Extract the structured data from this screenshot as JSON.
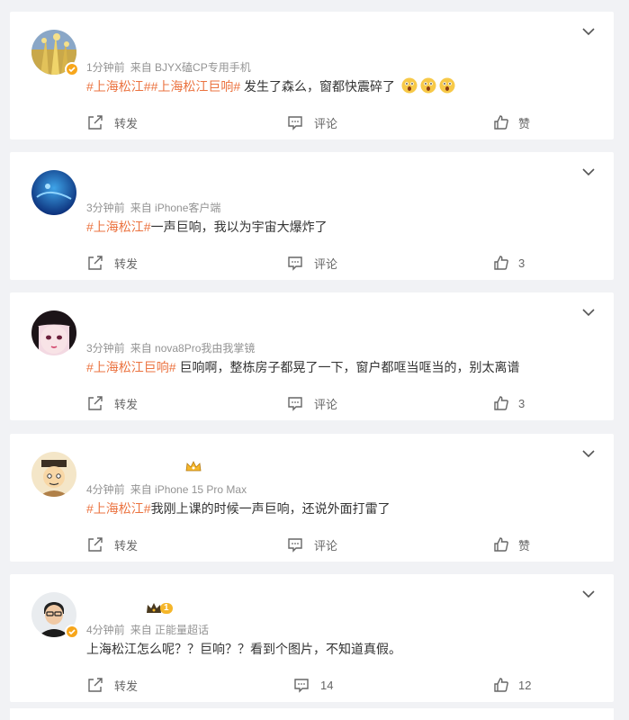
{
  "posts": [
    {
      "time": "1分钟前",
      "source": "来自 BJYX磕CP专用手机",
      "tags": [
        "#上海松江#",
        "#上海松江巨响#"
      ],
      "text": " 发生了森么，窗都快震碎了",
      "emoji_count": 3,
      "emoji_name": "shocked-face-emoji",
      "share_label": "转发",
      "comment_label": "评论",
      "like_label": "赞",
      "verified": true
    },
    {
      "time": "3分钟前",
      "source": "来自 iPhone客户端",
      "tags": [
        "#上海松江#"
      ],
      "text": "一声巨响，我以为宇宙大爆炸了",
      "share_label": "转发",
      "comment_label": "评论",
      "like_label": "3",
      "verified": false
    },
    {
      "time": "3分钟前",
      "source": "来自 nova8Pro我由我掌镜",
      "tags": [
        "#上海松江巨响#"
      ],
      "text": " 巨响啊，整栋房子都晃了一下，窗户都哐当哐当的，别太离谱",
      "share_label": "转发",
      "comment_label": "评论",
      "like_label": "3",
      "verified": false
    },
    {
      "time": "4分钟前",
      "source": "来自 iPhone 15 Pro Max",
      "tags": [
        "#上海松江#"
      ],
      "text": "我刚上课的时候一声巨响，还说外面打雷了",
      "share_label": "转发",
      "comment_label": "评论",
      "like_label": "赞",
      "verified": false
    },
    {
      "time": "4分钟前",
      "source": "来自 正能量超话",
      "tags": [],
      "text": "上海松江怎么呢？？巨响？？看到个图片，不知道真假。",
      "share_label": "转发",
      "comment_label": "14",
      "like_label": "12",
      "level_badge": "1",
      "verified": true
    }
  ],
  "colors": {
    "tag": "#eb7340",
    "meta": "#939393",
    "text": "#333333",
    "action": "#666666",
    "background": "#f1f2f5",
    "verified": "#f7a61b"
  },
  "icons": {
    "share": "share-icon",
    "comment": "comment-icon",
    "like": "thumbs-up-icon",
    "menu": "chevron-down-icon"
  }
}
